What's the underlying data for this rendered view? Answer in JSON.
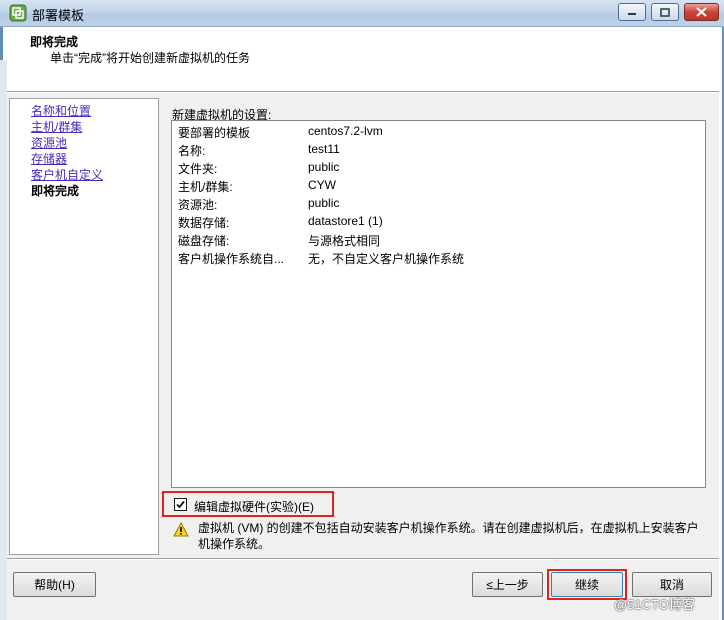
{
  "window": {
    "title": "部署模板",
    "app_icon": "vsphere-icon",
    "controls": [
      "minimize-icon",
      "maximize-icon",
      "close-icon"
    ]
  },
  "header": {
    "title": "即将完成",
    "subtitle": "单击“完成”将开始创建新虚拟机的任务"
  },
  "nav": {
    "items": [
      {
        "label": "名称和位置",
        "state": "link"
      },
      {
        "label": "主机/群集",
        "state": "link"
      },
      {
        "label": "资源池",
        "state": "link"
      },
      {
        "label": "存储器",
        "state": "link"
      },
      {
        "label": "客户机自定义",
        "state": "link"
      },
      {
        "label": "即将完成",
        "state": "current"
      }
    ]
  },
  "settings": {
    "label": "新建虚拟机的设置:",
    "rows": [
      {
        "key": "要部署的模板",
        "value": "centos7.2-lvm"
      },
      {
        "key": "名称:",
        "value": "test11"
      },
      {
        "key": "文件夹:",
        "value": "public"
      },
      {
        "key": "主机/群集:",
        "value": "CYW"
      },
      {
        "key": "资源池:",
        "value": "public"
      },
      {
        "key": "数据存储:",
        "value": "datastore1 (1)"
      },
      {
        "key": "磁盘存储:",
        "value": "与源格式相同"
      },
      {
        "key": "客户机操作系统自...",
        "value": "无，不自定义客户机操作系统"
      }
    ]
  },
  "edit_hardware": {
    "label": "编辑虚拟硬件(实验)(E)",
    "checked": true
  },
  "warning": {
    "icon": "warning-icon",
    "text": "虚拟机 (VM) 的创建不包括自动安装客户机操作系统。请在创建虚拟机后，在虚拟机上安装客户机操作系统。"
  },
  "buttons": {
    "help": "帮助(H)",
    "back": "≤上一步",
    "next": "继续",
    "cancel": "取消"
  },
  "watermark": "@51CTO博客",
  "colors": {
    "link": "#4b2bb8",
    "highlight_box": "#e0241b",
    "titlebar": "#c2d6ea"
  }
}
